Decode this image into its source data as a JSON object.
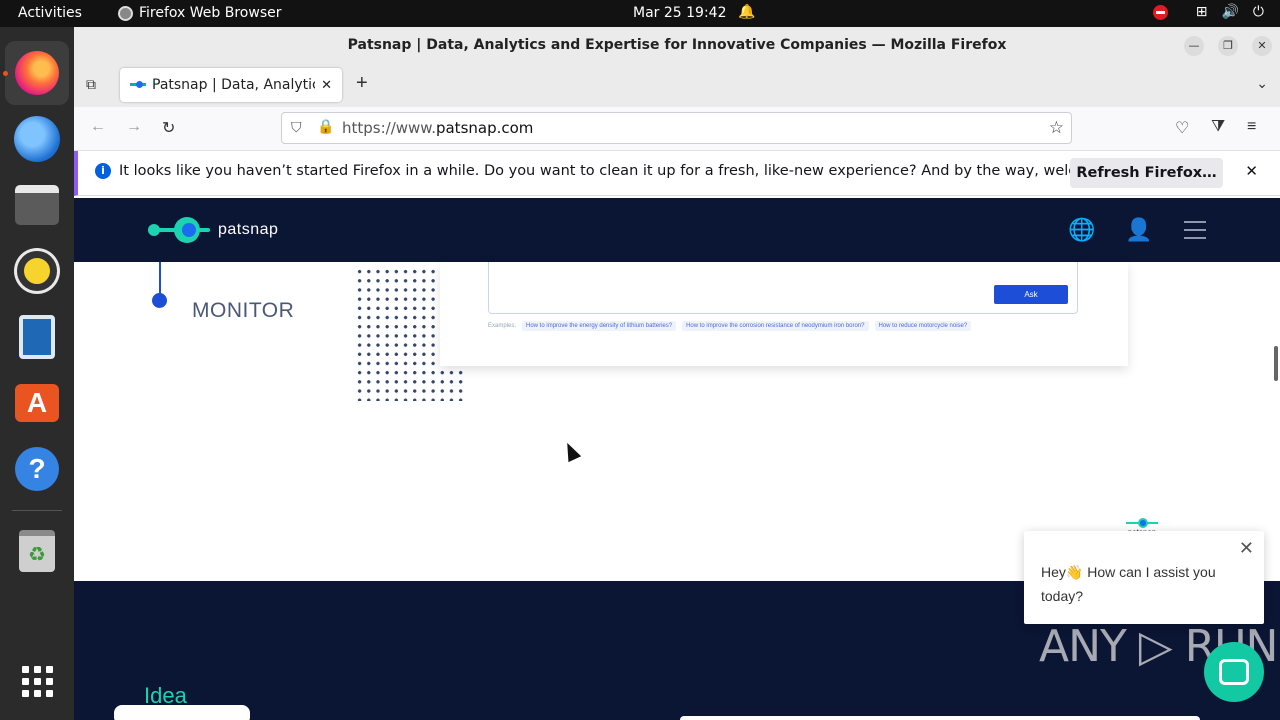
{
  "topbar": {
    "activities": "Activities",
    "app_name": "Firefox Web Browser",
    "clock": "Mar 25  19:42"
  },
  "window": {
    "title": "Patsnap | Data, Analytics and Expertise for Innovative Companies — Mozilla Firefox"
  },
  "tab": {
    "title": "Patsnap | Data, Analytics"
  },
  "urlbar": {
    "prefix": "https://www.",
    "domain": "patsnap.com"
  },
  "notification": {
    "message": "It looks like you haven’t started Firefox in a while. Do you want to clean it up for a fresh, like-new experience? And by the way, welcome back!",
    "refresh_label": "Refresh Firefox…"
  },
  "site": {
    "logo_text": "patsnap",
    "monitor_label": "MONITOR",
    "ask_label": "Ask",
    "examples_label": "Examples:",
    "examples": [
      "How to improve the energy density of lithium batteries?",
      "How to improve the corrosion resistance of neodymium iron boron?",
      "How to reduce motorcycle noise?"
    ],
    "idea_label": "Idea"
  },
  "chat": {
    "logo_text": "patsnap",
    "message": "Hey👋 How can I assist you today?"
  },
  "watermark": "ANY ▷ RUN",
  "colors": {
    "site_navy": "#0b1534",
    "brand_teal": "#1bd3b0",
    "brand_blue": "#1d4ed8",
    "notif_accent": "#8b5cf6"
  }
}
